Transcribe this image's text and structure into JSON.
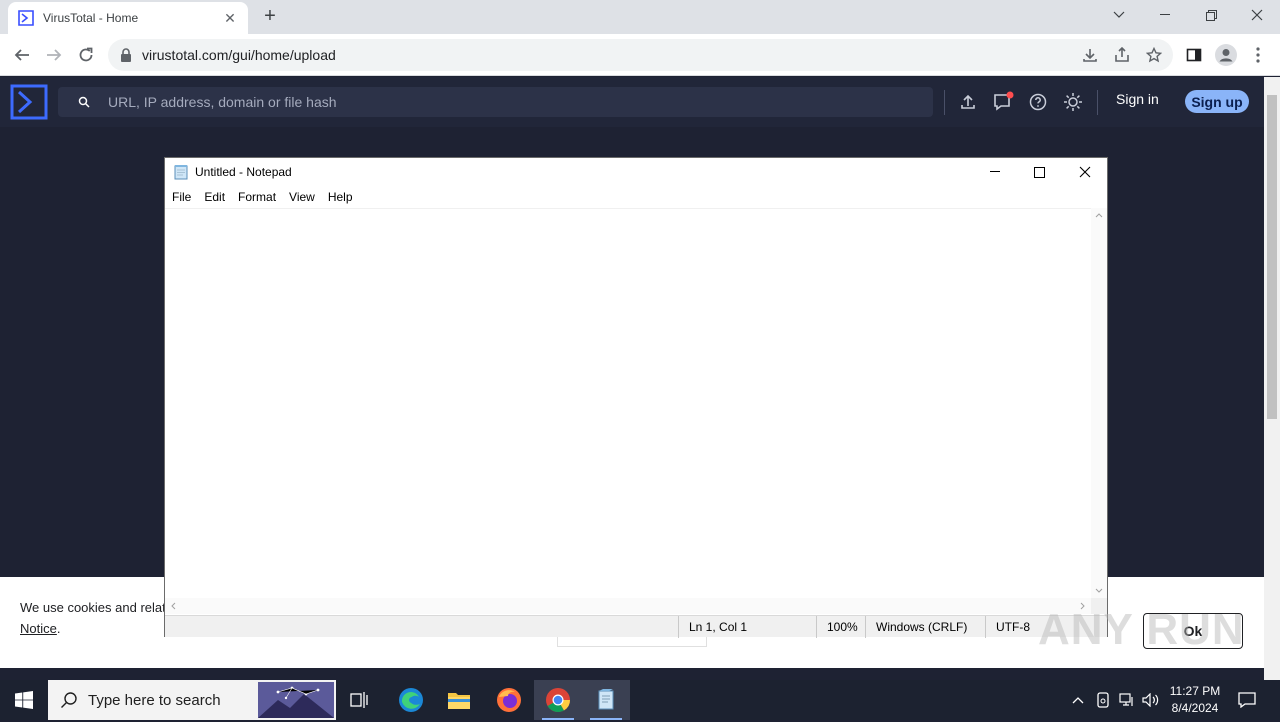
{
  "browser": {
    "tab_title": "VirusTotal - Home",
    "tab_close": "✕",
    "new_tab": "+",
    "url": "virustotal.com/gui/home/upload"
  },
  "virustotal": {
    "search_placeholder": "URL, IP address, domain or file hash",
    "sign_in": "Sign in",
    "sign_up": "Sign up",
    "brand_color": "#212639"
  },
  "cookie_banner": {
    "text": "We use cookies and relat",
    "notice_link": "Notice",
    "notice_suffix": ".",
    "ok_label": "Ok"
  },
  "notepad": {
    "title": "Untitled - Notepad",
    "menu": [
      "File",
      "Edit",
      "Format",
      "View",
      "Help"
    ],
    "status": {
      "position": "Ln 1, Col 1",
      "zoom": "100%",
      "line_ending": "Windows (CRLF)",
      "encoding": "UTF-8"
    }
  },
  "taskbar": {
    "search_placeholder": "Type here to search",
    "time": "11:27 PM",
    "date": "8/4/2024"
  },
  "watermark": "ANY RUN"
}
